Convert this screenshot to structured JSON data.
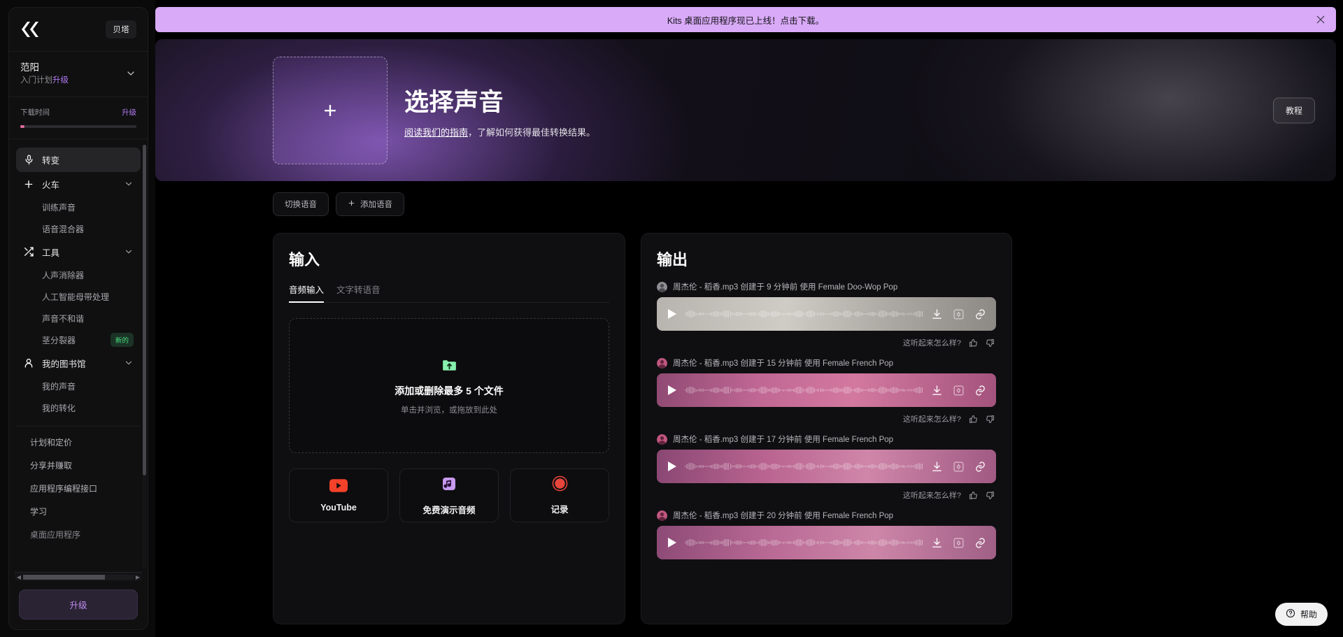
{
  "sidebar": {
    "logo_name": "kits-logo",
    "beta_label": "贝塔",
    "account": {
      "name": "范阳",
      "plan_prefix": "入门计划",
      "plan_upgrade": "升级"
    },
    "usage": {
      "label": "下载时间",
      "upgrade_label": "升级",
      "percent": 3.5
    },
    "nav": [
      {
        "label": "转变",
        "icon": "microphone-icon",
        "active": true,
        "expandable": false
      },
      {
        "label": "火车",
        "icon": "plus-icon",
        "active": false,
        "expandable": true
      },
      {
        "label": "训练声音",
        "sub": true
      },
      {
        "label": "语音混合器",
        "sub": true
      },
      {
        "label": "工具",
        "icon": "shuffle-icon",
        "active": false,
        "expandable": true
      },
      {
        "label": "人声消除器",
        "sub": true
      },
      {
        "label": "人工智能母带处理",
        "sub": true
      },
      {
        "label": "声音不和谐",
        "sub": true
      },
      {
        "label": "茎分裂器",
        "sub": true,
        "badge": "新的"
      },
      {
        "label": "我的图书馆",
        "icon": "user-icon",
        "active": false,
        "expandable": true
      },
      {
        "label": "我的声音",
        "sub": true
      },
      {
        "label": "我的转化",
        "sub": true
      }
    ],
    "links": [
      {
        "label": "计划和定价"
      },
      {
        "label": "分享并赚取"
      },
      {
        "label": "应用程序编程接口"
      },
      {
        "label": "学习"
      },
      {
        "label": "桌面应用程序"
      }
    ],
    "upgrade_button": "升级"
  },
  "banner": {
    "text": "Kits 桌面应用程序现已上线！点击下载。",
    "close_icon": "close-icon",
    "bg": "#d9aaf7"
  },
  "hero": {
    "add_icon": "plus-icon",
    "title": "选择声音",
    "sub_link": "阅读我们的指南",
    "sub_rest": "，了解如何获得最佳转换结果。",
    "tutorial_button": "教程"
  },
  "voice_actions": [
    {
      "label": "切换语音",
      "icon": ""
    },
    {
      "label": "添加语音",
      "icon": "plus-icon"
    }
  ],
  "input_panel": {
    "title": "输入",
    "tabs": [
      {
        "label": "音频输入",
        "active": true
      },
      {
        "label": "文字转语音",
        "active": false
      }
    ],
    "dropzone": {
      "icon": "folder-upload-icon",
      "title": "添加或删除最多 5 个文件",
      "sub": "单击并浏览，或拖放到此处"
    },
    "sources": [
      {
        "label": "YouTube",
        "icon": "youtube-icon",
        "color": "#f4412a"
      },
      {
        "label": "免费演示音频",
        "icon": "music-note-icon",
        "color": "#c79af0"
      },
      {
        "label": "记录",
        "icon": "record-icon",
        "color": "#e8453c"
      }
    ]
  },
  "output_panel": {
    "title": "输出",
    "feedback_label": "这听起来怎么样?",
    "items": [
      {
        "name": "周杰伦 - 稻香.mp3 创建于 9 分钟前 使用 Female Doo-Wop Pop",
        "avatar": "avatar-gray",
        "style": "p0"
      },
      {
        "name": "周杰伦 - 稻香.mp3 创建于 15 分钟前 使用 Female French Pop",
        "avatar": "avatar-pink",
        "style": "p1"
      },
      {
        "name": "周杰伦 - 稻香.mp3 创建于 17 分钟前 使用 Female French Pop",
        "avatar": "avatar-pink",
        "style": "p2"
      },
      {
        "name": "周杰伦 - 稻香.mp3 创建于 20 分钟前 使用 Female French Pop",
        "avatar": "avatar-pink",
        "style": "p3"
      }
    ],
    "player_actions": [
      "download-icon",
      "save-to-library-icon",
      "copy-link-icon"
    ],
    "feedback_actions": [
      "thumbs-up-icon",
      "thumbs-down-icon"
    ]
  },
  "help": {
    "label": "帮助",
    "icon": "question-circle-icon"
  }
}
